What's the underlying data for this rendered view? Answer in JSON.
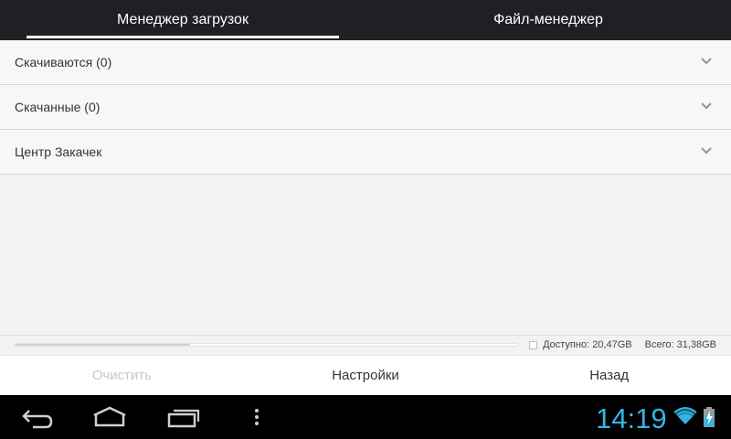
{
  "tabs": [
    {
      "label": "Менеджер загрузок",
      "active": true
    },
    {
      "label": "Файл-менеджер",
      "active": false
    }
  ],
  "sections": [
    {
      "label": "Скачиваются (0)"
    },
    {
      "label": "Скачанные (0)"
    },
    {
      "label": "Центр Закачек"
    }
  ],
  "storage": {
    "available": "Доступно: 20,47GB",
    "total": "Всего: 31,38GB",
    "used_fraction": 0.348
  },
  "actions": {
    "clear": "Очистить",
    "settings": "Настройки",
    "back": "Назад"
  },
  "status_bar": {
    "time": "14:19",
    "accent_color": "#33b5e5"
  },
  "icons": [
    "chevron-down-icon",
    "back-icon",
    "home-icon",
    "recent-apps-icon",
    "menu-icon",
    "wifi-icon",
    "battery-icon"
  ]
}
